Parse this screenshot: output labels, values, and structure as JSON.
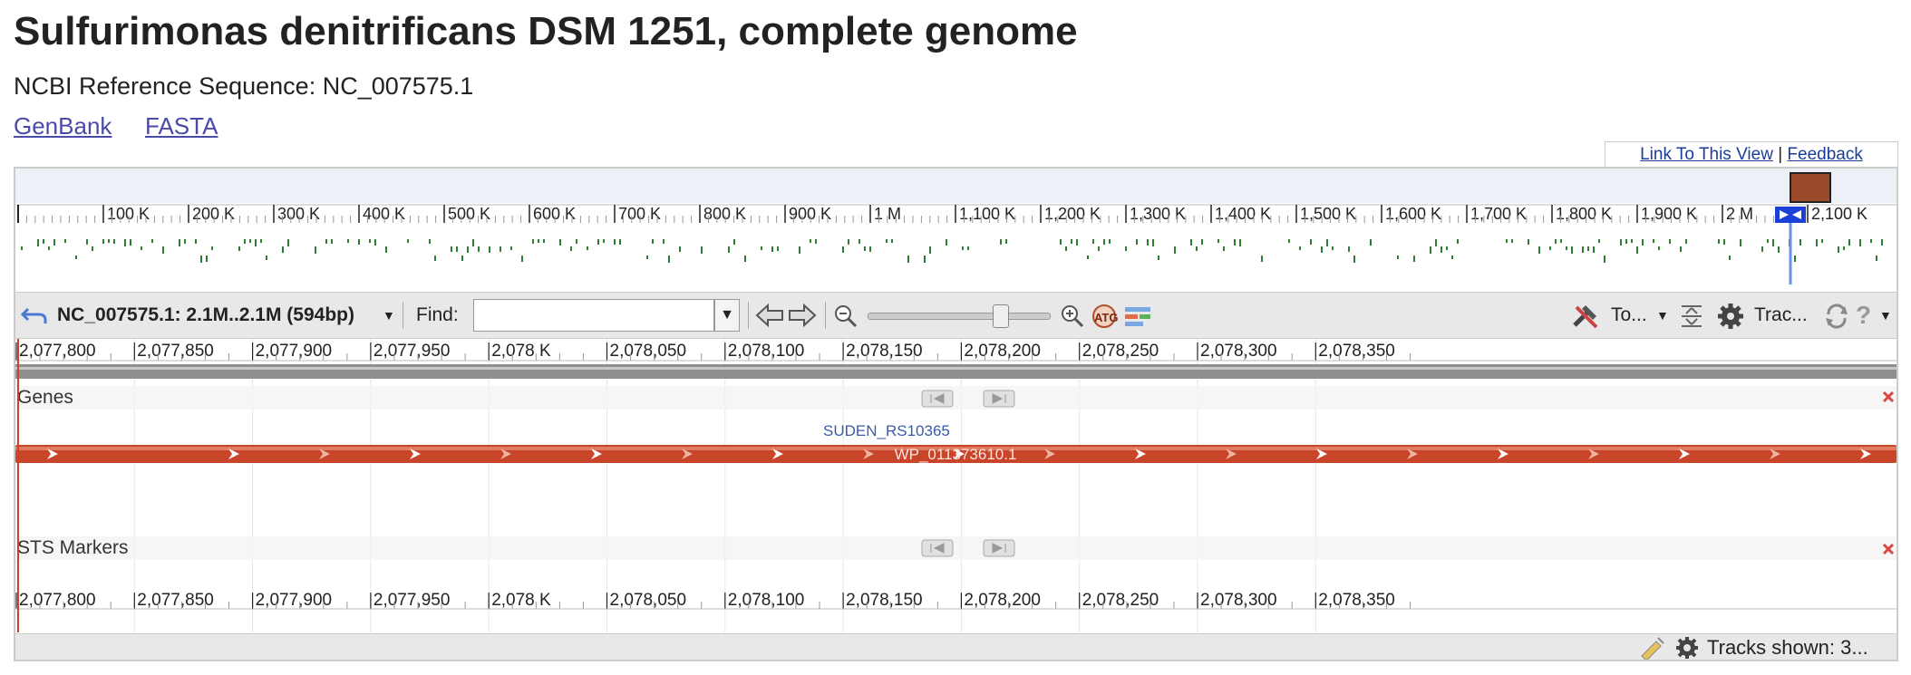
{
  "page": {
    "title": "Sulfurimonas denitrificans DSM 1251, complete genome",
    "refseq": "NCBI Reference Sequence: NC_007575.1",
    "links": [
      "GenBank",
      "FASTA"
    ]
  },
  "view_links": {
    "link_label": "Link To This View",
    "separator": "|",
    "feedback_label": "Feedback"
  },
  "overview": {
    "ticks": [
      "100 K",
      "200 K",
      "300 K",
      "400 K",
      "500 K",
      "600 K",
      "700 K",
      "800 K",
      "900 K",
      "1 M",
      "1,100 K",
      "1,200 K",
      "1,300 K",
      "1,400 K",
      "1,500 K",
      "1,600 K",
      "1,700 K",
      "1,800 K",
      "1,900 K",
      "2 M",
      "2,100 K"
    ]
  },
  "toolbar": {
    "location": "NC_007575.1: 2.1M..2.1M (594bp)",
    "find_label": "Find:",
    "find_value": "",
    "tools_label": "To...",
    "tracks_label": "Trac..."
  },
  "ruler": {
    "ticks": [
      "2,077,800",
      "2,077,850",
      "2,077,900",
      "2,077,950",
      "2,078 K",
      "2,078,050",
      "2,078,100",
      "2,078,150",
      "2,078,200",
      "2,078,250",
      "2,078,300",
      "2,078,350"
    ]
  },
  "tracks": {
    "genes": {
      "label": "Genes",
      "gene_label": "SUDEN_RS10365",
      "feature_label": "WP_011373610.1"
    },
    "sts": {
      "label": "STS Markers"
    }
  },
  "status": {
    "tracks_shown": "Tracks shown: 3..."
  },
  "colors": {
    "gene_bar": "#c8452a",
    "accent_link": "#4a4aa8",
    "overview_marks": "#2e7d32",
    "marker_box": "#9b4a2c"
  }
}
